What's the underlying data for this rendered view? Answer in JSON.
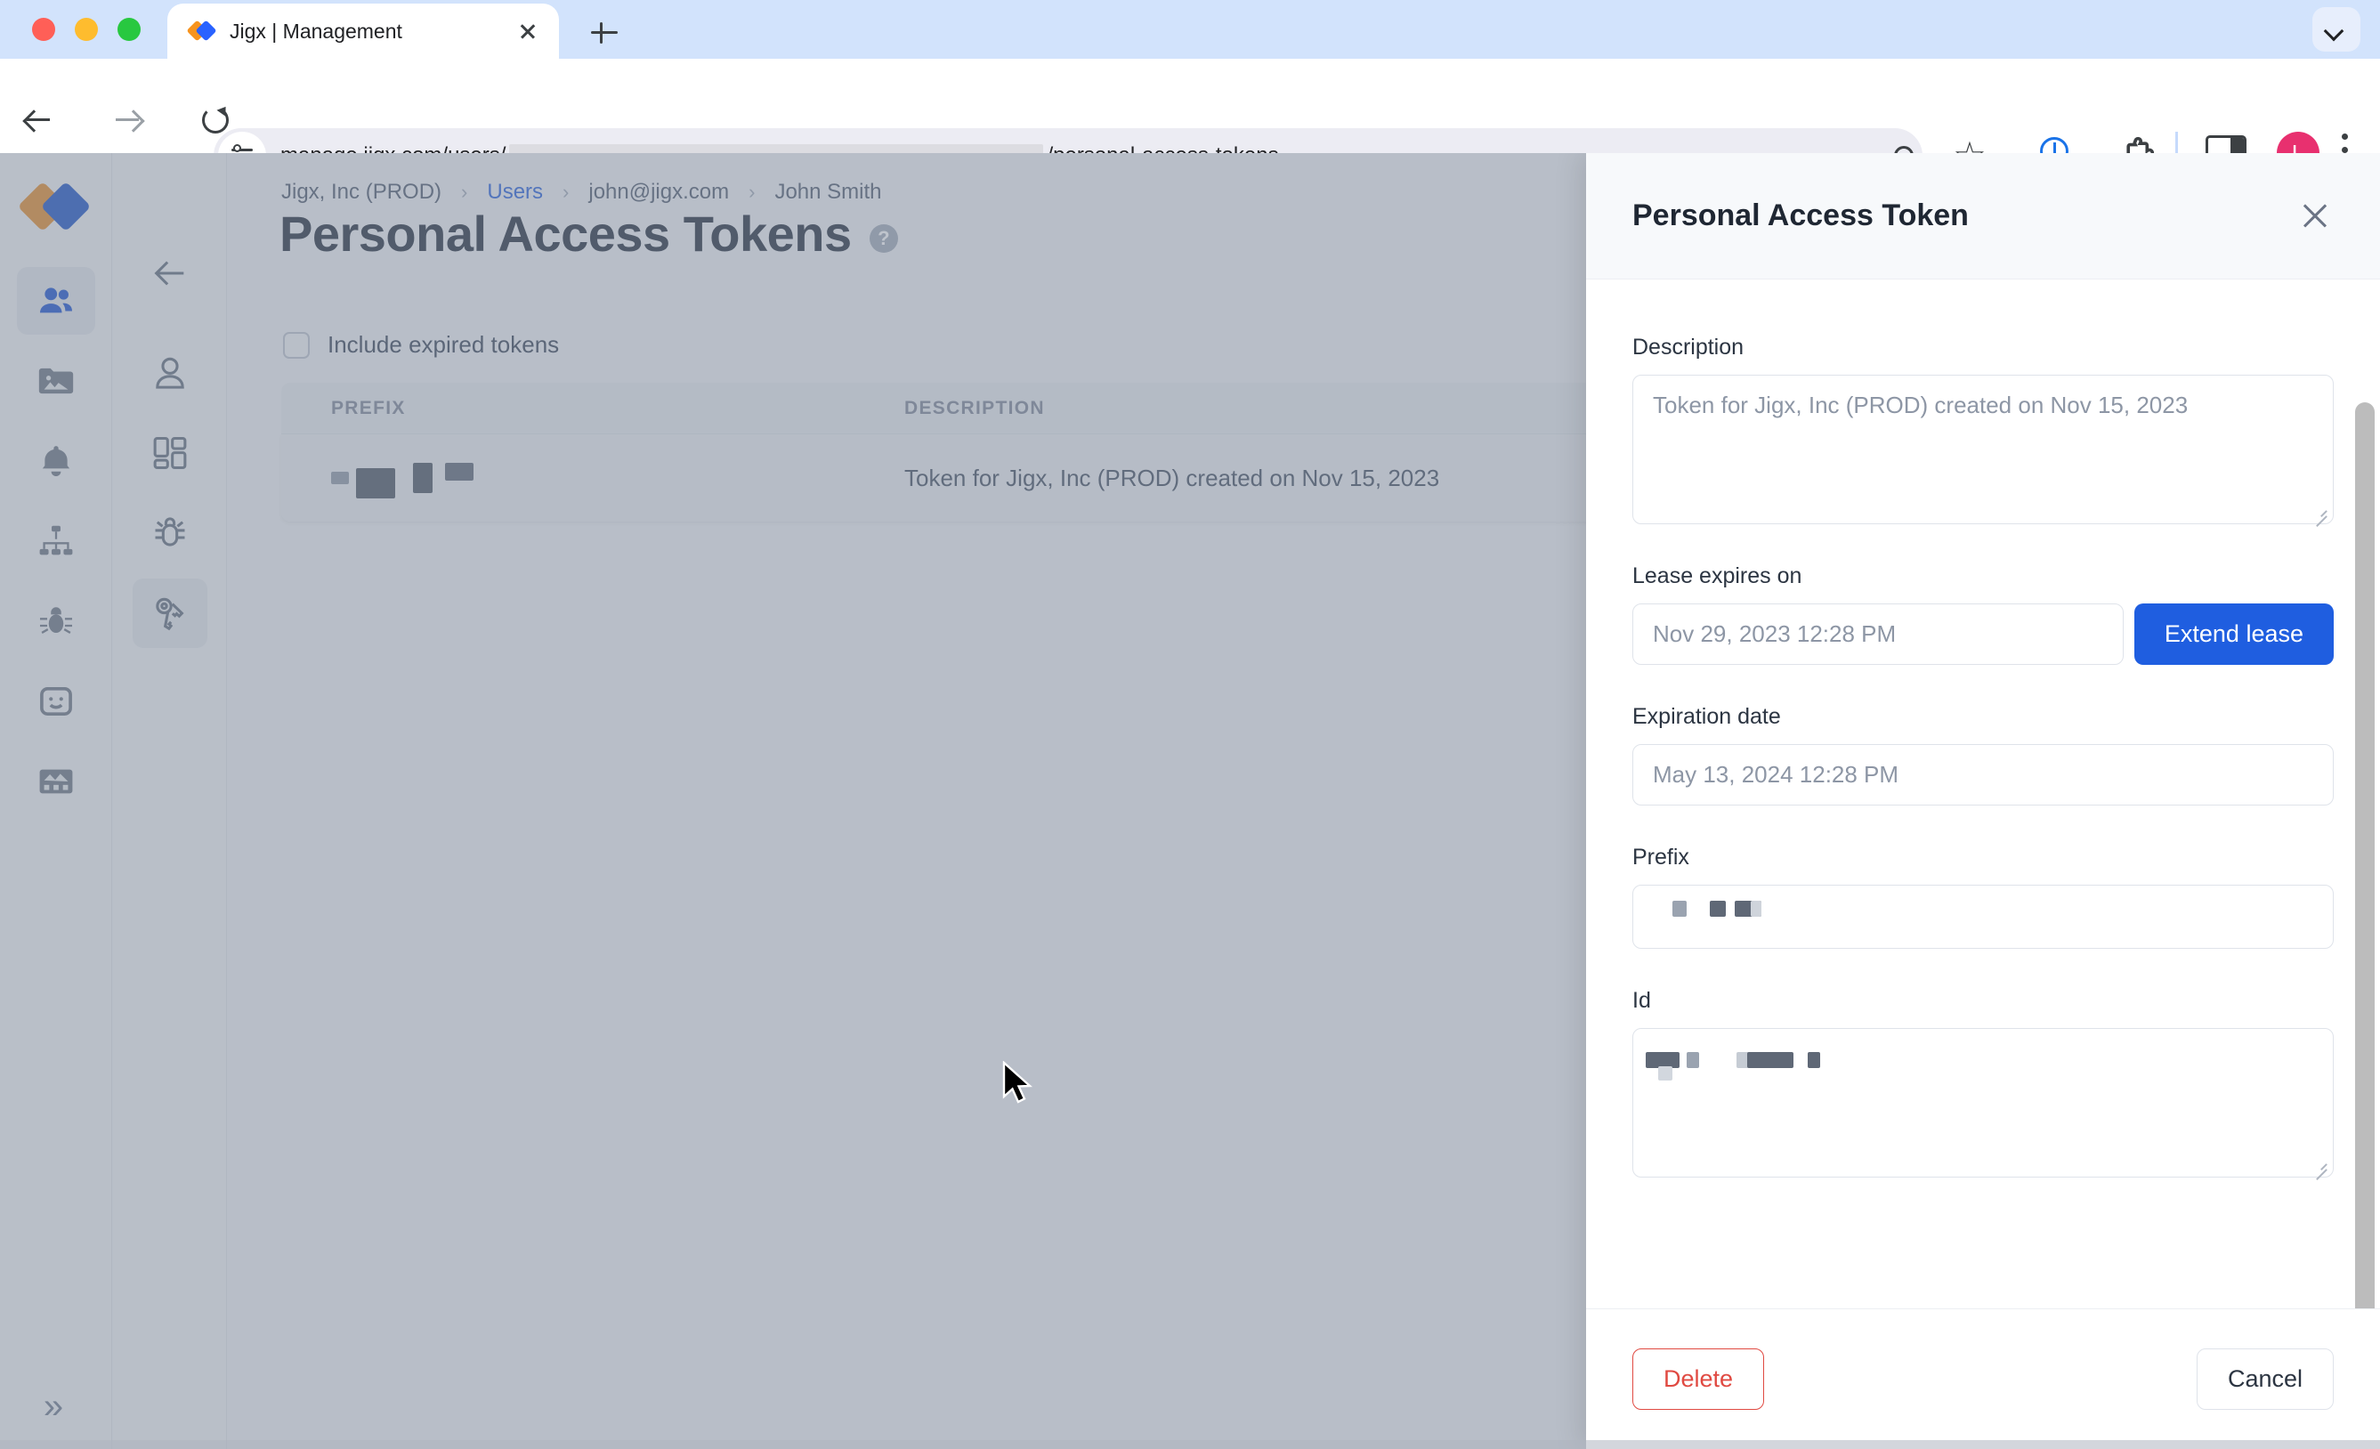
{
  "browser": {
    "tab": {
      "title": "Jigx | Management",
      "favicon": "jigx-diamond-logo"
    },
    "new_tab_label": "+",
    "url_prefix": "manage.jigx.com/users/",
    "url_suffix": "/personal-access-tokens",
    "toolbar_icons": [
      "password-key-icon",
      "bookmark-star-icon",
      "tracking-protection-icon",
      "extensions-puzzle-icon",
      "side-panel-icon",
      "profile-avatar",
      "chrome-menu-kebab-icon"
    ],
    "profile_initial": "L"
  },
  "sidebar_primary": {
    "logo": "jigx-logo",
    "items": [
      {
        "name": "users",
        "icon": "users-group-icon",
        "selected": true
      },
      {
        "name": "media",
        "icon": "image-folder-icon",
        "selected": false
      },
      {
        "name": "notifications",
        "icon": "bell-icon",
        "selected": false
      },
      {
        "name": "hierarchy",
        "icon": "org-chart-icon",
        "selected": false
      },
      {
        "name": "debug",
        "icon": "bug-icon",
        "selected": false
      },
      {
        "name": "bots",
        "icon": "robot-face-icon",
        "selected": false
      },
      {
        "name": "analytics",
        "icon": "analytics-bar-icon",
        "selected": false
      }
    ],
    "collapse_label": "»"
  },
  "sidebar_secondary": {
    "back_icon": "arrow-left-icon",
    "items": [
      {
        "name": "profile",
        "icon": "person-icon",
        "selected": false
      },
      {
        "name": "apps",
        "icon": "grid-blocks-icon",
        "selected": false
      },
      {
        "name": "issues",
        "icon": "bug-outline-icon",
        "selected": false
      },
      {
        "name": "personal-access-tokens",
        "icon": "keys-icon",
        "selected": true
      }
    ],
    "collapse_label": "›"
  },
  "breadcrumb": {
    "items": [
      {
        "label": "Jigx, Inc (PROD)",
        "link": false
      },
      {
        "label": "Users",
        "link": true
      },
      {
        "label": "john@jigx.com",
        "link": false
      },
      {
        "label": "John Smith",
        "link": false
      }
    ],
    "separator": "›"
  },
  "page": {
    "title": "Personal Access Tokens",
    "help_badge": "?",
    "include_expired_label": "Include expired tokens",
    "include_expired_checked": false
  },
  "table": {
    "columns": [
      "PREFIX",
      "DESCRIPTION"
    ],
    "rows": [
      {
        "prefix": "[redacted]",
        "description": "Token for Jigx, Inc (PROD) created on Nov 15, 2023"
      }
    ]
  },
  "panel": {
    "title": "Personal Access Token",
    "close_icon": "close-icon",
    "fields": {
      "description_label": "Description",
      "description_value": "Token for Jigx, Inc (PROD) created on Nov 15, 2023",
      "lease_label": "Lease expires on",
      "lease_value": "Nov 29, 2023 12:28 PM",
      "extend_label": "Extend lease",
      "expiration_label": "Expiration date",
      "expiration_value": "May 13, 2024 12:28 PM",
      "prefix_label": "Prefix",
      "prefix_value": "[redacted]",
      "id_label": "Id",
      "id_value": "[redacted]"
    },
    "footer": {
      "delete_label": "Delete",
      "cancel_label": "Cancel"
    }
  },
  "colors": {
    "accent_blue": "#1f5ee0",
    "danger_red": "#e04a42",
    "link_blue": "#3b6fe0",
    "chrome_tabstrip": "#d2e3fc",
    "avatar_pink": "#e8306f"
  }
}
